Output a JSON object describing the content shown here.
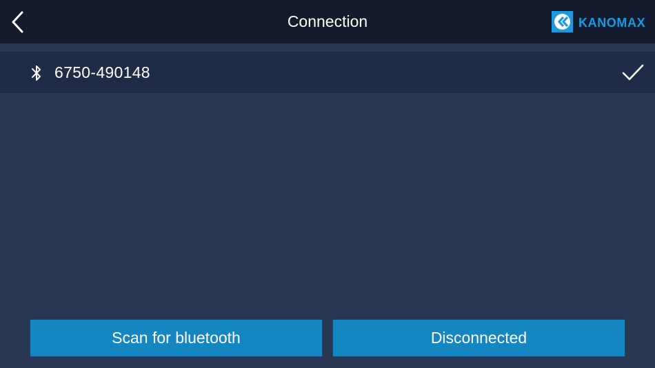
{
  "header": {
    "title": "Connection",
    "back_icon": "chevron-left-icon",
    "logo_text": "KANOMAX",
    "logo_color": "#1a9be0"
  },
  "devices": [
    {
      "name": "6750-490148",
      "icon": "bluetooth-icon",
      "selected": true,
      "status_icon": "checkmark-icon"
    }
  ],
  "actions": {
    "scan_label": "Scan for bluetooth",
    "connection_status_label": "Disconnected"
  },
  "colors": {
    "background": "#293753",
    "header": "#141b2c",
    "row": "#1f2c47",
    "button": "#1487c2"
  }
}
